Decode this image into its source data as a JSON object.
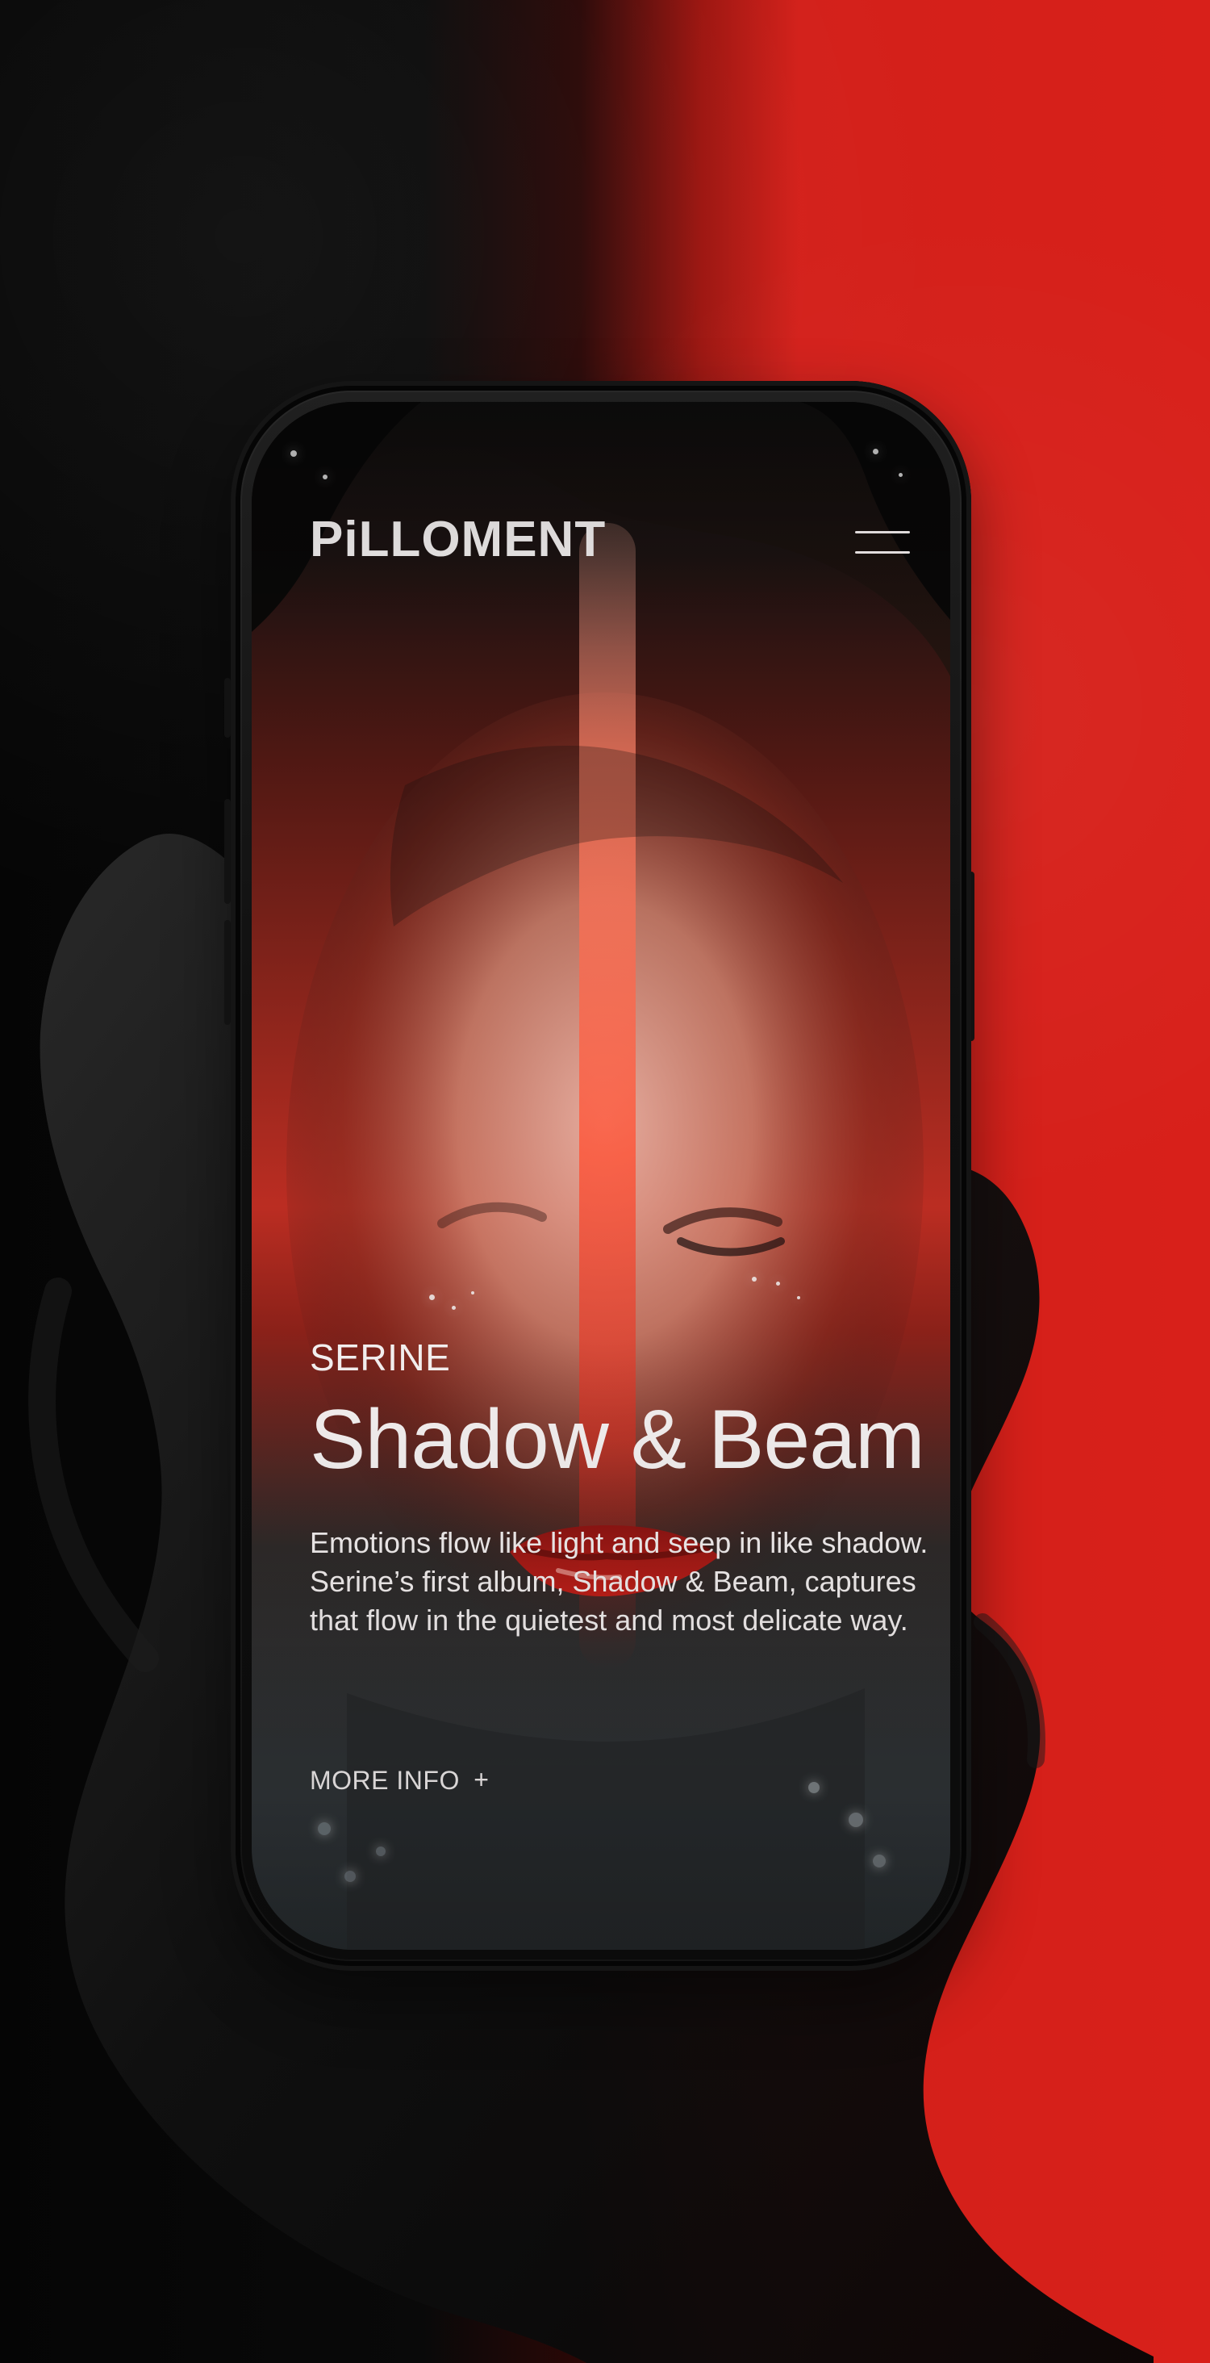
{
  "header": {
    "brand": "PiLLOMENT"
  },
  "hero": {
    "artist": "SERINE",
    "title": "Shadow & Beam",
    "description": "Emotions flow like light and seep in like shadow. Serine’s first album, Shadow & Beam, captures that flow in the quietest and most delicate way.",
    "cta_label": "MORE INFO",
    "cta_icon": "+"
  },
  "icons": {
    "menu": "menu-icon",
    "plus": "plus-icon"
  },
  "colors": {
    "background_left": "#050505",
    "background_right": "#d3201a",
    "text": "#f3efef"
  }
}
